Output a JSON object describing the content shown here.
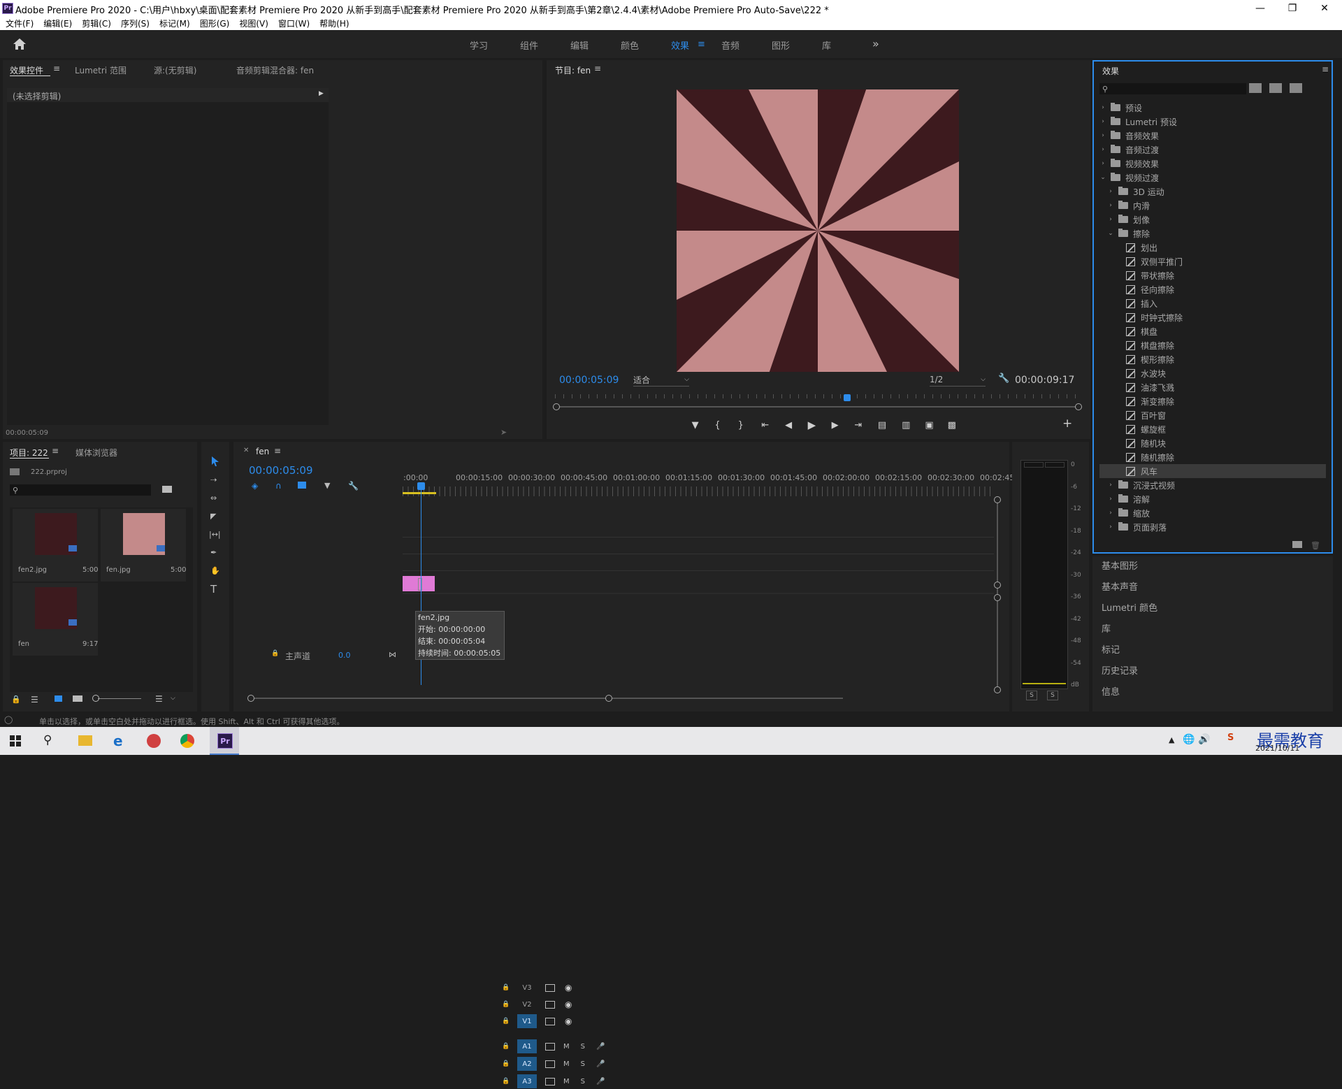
{
  "window": {
    "title": "Adobe Premiere Pro 2020 - C:\\用户\\hbxy\\桌面\\配套素材 Premiere Pro 2020 从新手到高手\\配套素材 Premiere Pro 2020 从新手到高手\\第2章\\2.4.4\\素材\\Adobe Premiere Pro Auto-Save\\222 *",
    "logo": "Pr"
  },
  "menu": [
    "文件(F)",
    "编辑(E)",
    "剪辑(C)",
    "序列(S)",
    "标记(M)",
    "图形(G)",
    "视图(V)",
    "窗口(W)",
    "帮助(H)"
  ],
  "workspaces": [
    "学习",
    "组件",
    "编辑",
    "颜色",
    "效果",
    "音频",
    "图形",
    "库"
  ],
  "workspace_active": "效果",
  "source_panel": {
    "tabs": [
      "效果控件",
      "Lumetri 范围",
      "源:(无剪辑)",
      "音频剪辑混合器: fen"
    ],
    "no_clip": "(未选择剪辑)",
    "timecode": "00:00:05:09"
  },
  "program": {
    "title": "节目: fen",
    "timecode": "00:00:05:09",
    "fit": "适合",
    "resolution": "1/2",
    "duration": "00:00:09:17",
    "colors": {
      "light": "#c48a8a",
      "dark": "#3d1a1e"
    }
  },
  "effects_panel": {
    "title": "效果",
    "tree": [
      {
        "label": "预设",
        "type": "folder",
        "level": 0,
        "open": false
      },
      {
        "label": "Lumetri 预设",
        "type": "folder",
        "level": 0,
        "open": false
      },
      {
        "label": "音频效果",
        "type": "folder",
        "level": 0,
        "open": false
      },
      {
        "label": "音频过渡",
        "type": "folder",
        "level": 0,
        "open": false
      },
      {
        "label": "视频效果",
        "type": "folder",
        "level": 0,
        "open": false
      },
      {
        "label": "视频过渡",
        "type": "folder",
        "level": 0,
        "open": true
      },
      {
        "label": "3D 运动",
        "type": "folder",
        "level": 1,
        "open": false
      },
      {
        "label": "内滑",
        "type": "folder",
        "level": 1,
        "open": false
      },
      {
        "label": "划像",
        "type": "folder",
        "level": 1,
        "open": false
      },
      {
        "label": "擦除",
        "type": "folder",
        "level": 1,
        "open": true
      },
      {
        "label": "划出",
        "type": "fx",
        "level": 2
      },
      {
        "label": "双侧平推门",
        "type": "fx",
        "level": 2
      },
      {
        "label": "带状擦除",
        "type": "fx",
        "level": 2
      },
      {
        "label": "径向擦除",
        "type": "fx",
        "level": 2
      },
      {
        "label": "插入",
        "type": "fx",
        "level": 2
      },
      {
        "label": "时钟式擦除",
        "type": "fx",
        "level": 2
      },
      {
        "label": "棋盘",
        "type": "fx",
        "level": 2
      },
      {
        "label": "棋盘擦除",
        "type": "fx",
        "level": 2
      },
      {
        "label": "楔形擦除",
        "type": "fx",
        "level": 2
      },
      {
        "label": "水波块",
        "type": "fx",
        "level": 2
      },
      {
        "label": "油漆飞溅",
        "type": "fx",
        "level": 2
      },
      {
        "label": "渐变擦除",
        "type": "fx",
        "level": 2
      },
      {
        "label": "百叶窗",
        "type": "fx",
        "level": 2
      },
      {
        "label": "螺旋框",
        "type": "fx",
        "level": 2
      },
      {
        "label": "随机块",
        "type": "fx",
        "level": 2
      },
      {
        "label": "随机擦除",
        "type": "fx",
        "level": 2
      },
      {
        "label": "风车",
        "type": "fx",
        "level": 2,
        "selected": true
      },
      {
        "label": "沉浸式视频",
        "type": "folder",
        "level": 1,
        "open": false
      },
      {
        "label": "溶解",
        "type": "folder",
        "level": 1,
        "open": false
      },
      {
        "label": "缩放",
        "type": "folder",
        "level": 1,
        "open": false
      },
      {
        "label": "页面剥落",
        "type": "folder",
        "level": 1,
        "open": false
      }
    ]
  },
  "side_panels": [
    "基本图形",
    "基本声音",
    "Lumetri 颜色",
    "库",
    "标记",
    "历史记录",
    "信息"
  ],
  "project": {
    "tabs": [
      "项目: 222",
      "媒体浏览器"
    ],
    "file": "222.prproj",
    "items": [
      {
        "name": "fen2.jpg",
        "dur": "5:00",
        "color": "#3d1a1e"
      },
      {
        "name": "fen.jpg",
        "dur": "5:00",
        "color": "#c48a8a"
      },
      {
        "name": "fen",
        "dur": "9:17",
        "color": "#3d1a1e"
      }
    ]
  },
  "timeline": {
    "tab": "fen",
    "timecode": "00:00:05:09",
    "ruler": [
      ":00:00",
      "00:00:15:00",
      "00:00:30:00",
      "00:00:45:00",
      "00:01:00:00",
      "00:01:15:00",
      "00:01:30:00",
      "00:01:45:00",
      "00:02:00:00",
      "00:02:15:00",
      "00:02:30:00",
      "00:02:45:"
    ],
    "video_tracks": [
      "V3",
      "V2",
      "V1"
    ],
    "audio_tracks": [
      "A1",
      "A2",
      "A3"
    ],
    "master": "主声道",
    "master_value": "0.0",
    "track_M": "M",
    "track_S": "S",
    "tooltip": {
      "name": "fen2.jpg",
      "start": "开始: 00:00:00:00",
      "end": "结束: 00:00:05:04",
      "duration": "持续时间: 00:00:05:05"
    }
  },
  "meter": {
    "scale": [
      "0",
      "-6",
      "-12",
      "-18",
      "-24",
      "-30",
      "-36",
      "-42",
      "-48",
      "-54",
      "dB"
    ],
    "solo": [
      "S",
      "S"
    ]
  },
  "status": "单击以选择，或单击空白处并拖动以进行框选。使用 Shift、Alt 和 Ctrl 可获得其他选项。",
  "taskbar": {
    "date": "2021/10/11",
    "watermark": "最需教育"
  },
  "colors": {
    "accent": "#2d8ceb",
    "clip": "#e07ad6",
    "track_on": "#1f5a8a"
  }
}
